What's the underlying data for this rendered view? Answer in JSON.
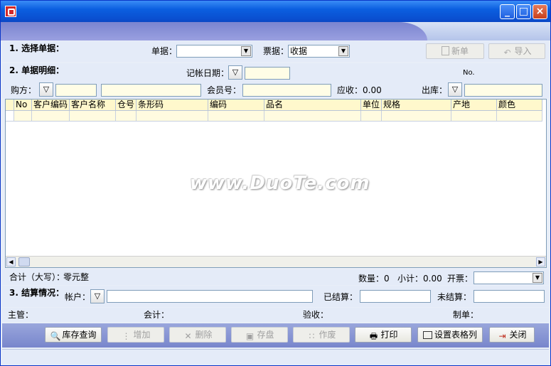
{
  "window": {
    "minimize": "_",
    "maximize": "□",
    "close": "×"
  },
  "section1": {
    "title": "1. 选择单据：",
    "bill_label": "单据：",
    "bill_value": "",
    "ticket_label": "票据：",
    "ticket_value": "收据",
    "new_btn": "新单",
    "import_btn": "导入"
  },
  "section2": {
    "title": "2. 单据明细：",
    "post_date_label": "记帐日期：",
    "post_date_value": "",
    "no_label": "No.",
    "buyer_label": "购方：",
    "buyer_code": "",
    "buyer_name": "",
    "member_label": "会员号：",
    "member_value": "",
    "receivable_label": "应收：",
    "receivable_value": "0.00",
    "outbound_label": "出库：",
    "outbound_value": ""
  },
  "grid": {
    "columns": [
      "No",
      "客户编码",
      "客户名称",
      "仓号",
      "条形码",
      "编码",
      "品名",
      "单位",
      "规格",
      "产地",
      "颜色"
    ],
    "watermark": "www.DuoTe.com"
  },
  "totals": {
    "uppercase_label": "合计（大写）：",
    "uppercase_value": "零元整",
    "qty_label": "数量：",
    "qty_value": "0",
    "subtotal_label": "小计：",
    "subtotal_value": "0.00",
    "invoice_label": "开票：",
    "invoice_value": ""
  },
  "section3": {
    "title": "3. 结算情况：",
    "account_label": "帐户：",
    "account_value": "",
    "settled_label": "已结算：",
    "settled_value": "",
    "unsettled_label": "未结算：",
    "unsettled_value": ""
  },
  "signatures": {
    "supervisor": "主管：",
    "accountant": "会计：",
    "receiver": "验收：",
    "maker": "制单："
  },
  "toolbar": {
    "inventory": "库存查询",
    "add": "增加",
    "delete": "删除",
    "save": "存盘",
    "void": "作废",
    "print": "打印",
    "columns": "设置表格列",
    "close": "关闭"
  },
  "colors": {
    "title_bar": "#0a5fe0",
    "accent_header": "#fff8cc",
    "toolbar": "#8894d4"
  }
}
